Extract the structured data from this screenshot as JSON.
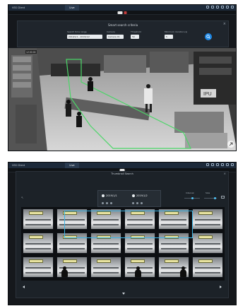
{
  "window1": {
    "app_title": "VSS Client",
    "tab_label": "Live",
    "panel": {
      "title": "Smart search criteria",
      "fields": [
        {
          "label": "Search time range",
          "value": "2019/1/1 - 2019/1/2"
        },
        {
          "label": "Camera",
          "value": "Camera 01"
        },
        {
          "label": "Threshold",
          "value": "50"
        },
        {
          "label": "Minimum duration (s)",
          "value": "5"
        }
      ]
    },
    "scene": {
      "clock": "12:00:00"
    }
  },
  "window2": {
    "app_title": "VSS Client",
    "tab_label": "Live",
    "panel": {
      "title": "Thumbnail Search",
      "start_date": "2019/1/1",
      "end_date": "2019/1/2",
      "interval_label": "Interval",
      "size_label": "Size"
    }
  },
  "colors": {
    "titlebar": "#1d2a3a",
    "accent": "#1e88e5",
    "roi_outline": "#4ad667",
    "selection": "#3bb5e6"
  }
}
